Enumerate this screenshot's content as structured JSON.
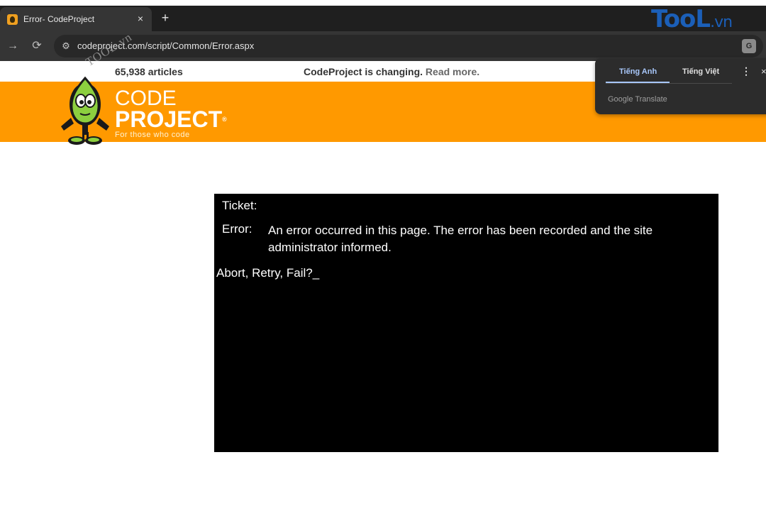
{
  "browser": {
    "tab_title": "Error- CodeProject",
    "tab_close": "×",
    "new_tab": "+",
    "url": "codeproject.com/script/Common/Error.aspx",
    "nav": {
      "forward_icon": "→",
      "reload_icon": "⟳",
      "site_settings_icon": "⚙"
    },
    "translate_icon_text": "G"
  },
  "watermark": {
    "brand_main": "T",
    "brand_o": "oo",
    "brand_l": "L",
    "brand_vn": ".vn",
    "diagonal_text": "TOOL.vn"
  },
  "page": {
    "articles": "65,938 articles",
    "changing": "CodeProject is changing.",
    "read_more": "Read more.",
    "logo": {
      "code": "CODE",
      "project": "PROJECT",
      "reg": "®",
      "tagline": "For those who code"
    }
  },
  "translate_popup": {
    "tab_source": "Tiếng Anh",
    "tab_target": "Tiếng Việt",
    "menu_icon": "⋮",
    "close_icon": "×",
    "brand": "Google Translate"
  },
  "console": {
    "ticket_label": "Ticket:",
    "error_label": "Error:",
    "error_message": "An error occurred in this page. The error has been recorded and the site administrator informed.",
    "prompt": "Abort, Retry, Fail?_"
  },
  "colors": {
    "header_orange": "#ff9900",
    "console_bg": "#000000",
    "translate_accent": "#a8c7fa",
    "brand_blue": "#1b5fb8"
  }
}
